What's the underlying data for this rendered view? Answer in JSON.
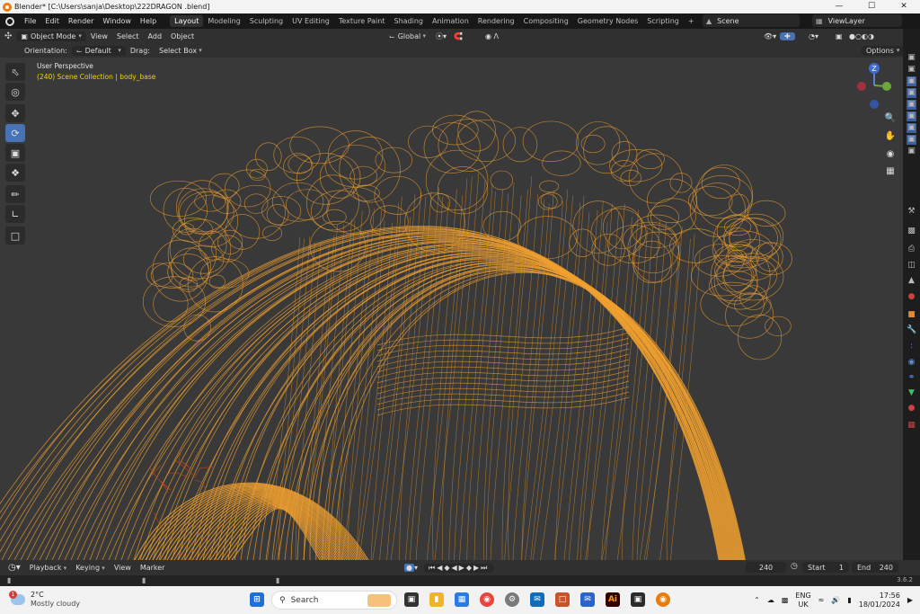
{
  "window": {
    "title": "Blender* [C:\\Users\\sanja\\Desktop\\222DRAGON .blend]",
    "controls": [
      "—",
      "☐",
      "✕"
    ]
  },
  "menu": {
    "items": [
      "File",
      "Edit",
      "Render",
      "Window",
      "Help"
    ],
    "workspaces": [
      "Layout",
      "Modeling",
      "Sculpting",
      "UV Editing",
      "Texture Paint",
      "Shading",
      "Animation",
      "Rendering",
      "Compositing",
      "Geometry Nodes",
      "Scripting"
    ],
    "active_workspace": "Layout",
    "add_tab": "+",
    "scene": "Scene",
    "view_layer": "ViewLayer"
  },
  "header": {
    "mode": "Object Mode",
    "menus": [
      "View",
      "Select",
      "Add",
      "Object"
    ],
    "transform": "Global",
    "orientation_label": "Orientation:",
    "orientation": "Default",
    "drag_label": "Drag:",
    "drag": "Select Box",
    "options": "Options"
  },
  "viewport": {
    "perspective": "User Perspective",
    "collection": "(240) Scene Collection | body_base",
    "wire_color": "#f0a030",
    "bg_color": "#393939",
    "gizmo": {
      "z": "Z"
    }
  },
  "timeline": {
    "menus": [
      "Playback",
      "Keying",
      "View",
      "Marker"
    ],
    "current_frame": "240",
    "start_label": "Start",
    "start": "1",
    "end_label": "End",
    "end": "240"
  },
  "status": {
    "version": "3.6.2"
  },
  "taskbar": {
    "temperature": "2°C",
    "weather": "Mostly cloudy",
    "search_placeholder": "Search",
    "language": "ENG",
    "region": "UK",
    "time": "17:56",
    "date": "18/01/2024",
    "weather_badge": "1",
    "ai_label": "Ai"
  }
}
